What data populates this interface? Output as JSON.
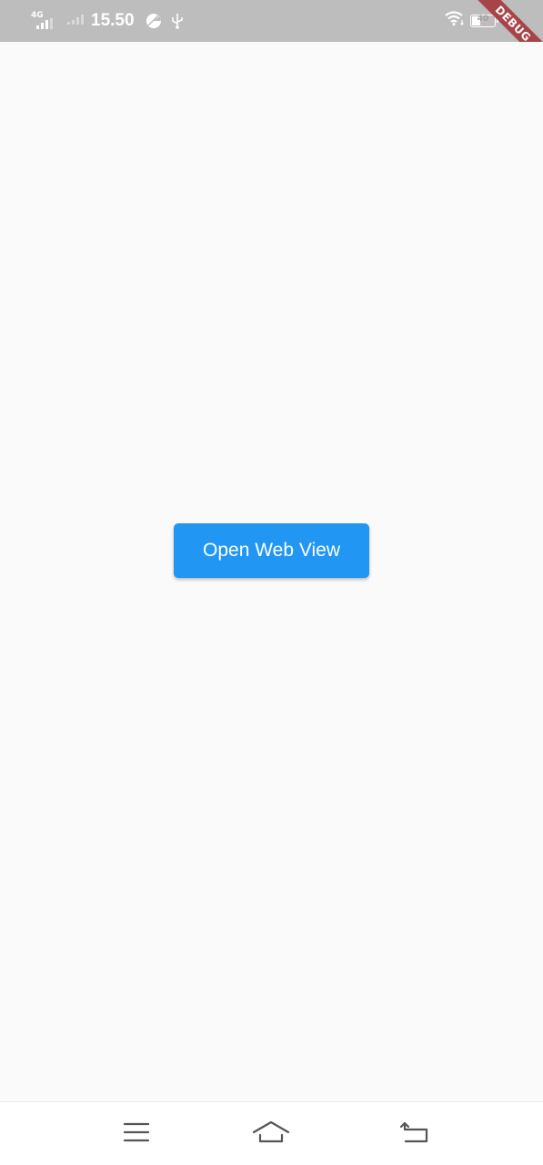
{
  "status_bar": {
    "network_label": "4G",
    "time": "15.50",
    "battery_label": "40",
    "battery_percent": 40,
    "icons": [
      "signal-4g-icon",
      "signal-icon",
      "data-saver-icon",
      "usb-icon",
      "wifi-icon",
      "battery-icon",
      "charging-icon"
    ]
  },
  "debug_banner": {
    "label": "DEBUG"
  },
  "main": {
    "open_button_label": "Open Web View",
    "button_color": "#2196f3",
    "background_color": "#fafafa"
  },
  "nav_bar": {
    "icons": [
      "menu-icon",
      "home-icon",
      "back-icon"
    ]
  }
}
